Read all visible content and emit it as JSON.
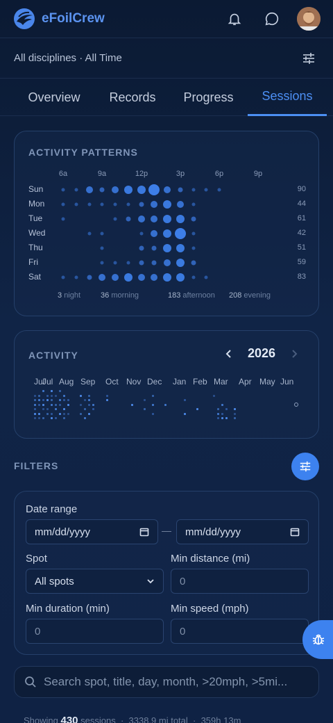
{
  "app": {
    "name": "eFoilCrew"
  },
  "context": {
    "label": "All disciplines · All Time"
  },
  "tabs": [
    {
      "label": "Overview"
    },
    {
      "label": "Records"
    },
    {
      "label": "Progress"
    },
    {
      "label": "Sessions",
      "active": true
    }
  ],
  "patterns": {
    "title": "ACTIVITY PATTERNS",
    "hour_labels": [
      "6a",
      "9a",
      "12p",
      "3p",
      "6p",
      "9p"
    ],
    "days": [
      {
        "label": "Sun",
        "total": "90",
        "levels": [
          0,
          0,
          0,
          0,
          0,
          0,
          1,
          1,
          3,
          2,
          3,
          4,
          4,
          5,
          3,
          2,
          1,
          1,
          1,
          0,
          0,
          0,
          0,
          0
        ]
      },
      {
        "label": "Mon",
        "total": "44",
        "levels": [
          0,
          0,
          0,
          1,
          0,
          0,
          1,
          1,
          1,
          1,
          1,
          1,
          2,
          3,
          4,
          3,
          1,
          0,
          0,
          0,
          0,
          0,
          0,
          0
        ]
      },
      {
        "label": "Tue",
        "total": "61",
        "levels": [
          0,
          0,
          0,
          0,
          0,
          0,
          1,
          0,
          0,
          0,
          1,
          2,
          3,
          3,
          4,
          4,
          2,
          0,
          0,
          0,
          0,
          0,
          0,
          0
        ]
      },
      {
        "label": "Wed",
        "total": "42",
        "levels": [
          0,
          0,
          0,
          0,
          0,
          0,
          0,
          0,
          1,
          1,
          0,
          0,
          1,
          3,
          4,
          5,
          1,
          0,
          0,
          0,
          0,
          0,
          0,
          0
        ]
      },
      {
        "label": "Thu",
        "total": "51",
        "levels": [
          0,
          0,
          0,
          0,
          0,
          0,
          0,
          0,
          0,
          1,
          0,
          0,
          2,
          2,
          4,
          4,
          1,
          0,
          0,
          0,
          0,
          0,
          0,
          0
        ]
      },
      {
        "label": "Fri",
        "total": "59",
        "levels": [
          0,
          0,
          0,
          0,
          1,
          0,
          0,
          0,
          0,
          1,
          1,
          1,
          2,
          2,
          3,
          4,
          2,
          0,
          0,
          0,
          0,
          0,
          0,
          0
        ]
      },
      {
        "label": "Sat",
        "total": "83",
        "levels": [
          0,
          0,
          0,
          0,
          0,
          0,
          1,
          1,
          2,
          3,
          3,
          4,
          3,
          3,
          4,
          4,
          1,
          1,
          0,
          0,
          0,
          0,
          0,
          0
        ]
      }
    ],
    "summary": [
      {
        "value": "3",
        "label": "night"
      },
      {
        "value": "36",
        "label": "morning"
      },
      {
        "value": "183",
        "label": "afternoon"
      },
      {
        "value": "208",
        "label": "evening"
      }
    ]
  },
  "activity": {
    "title": "ACTIVITY",
    "year": "2026",
    "months": [
      "Jul",
      "Jul",
      "Aug",
      "Sep",
      "Oct",
      "Nov",
      "Dec",
      "Jan",
      "Feb",
      "Mar",
      "Apr",
      "May",
      "Jun"
    ]
  },
  "filters": {
    "title": "FILTERS",
    "date_range_label": "Date range",
    "date_from": "mm/dd/yyyy",
    "date_to": "mm/dd/yyyy",
    "spot_label": "Spot",
    "spot_value": "All spots",
    "min_distance_label": "Min distance (mi)",
    "min_distance_value": "0",
    "min_duration_label": "Min duration (min)",
    "min_duration_value": "0",
    "min_speed_label": "Min speed (mph)",
    "min_speed_value": "0"
  },
  "search": {
    "placeholder": "Search spot, title, day, month, >20mph, >5mi..."
  },
  "footer": {
    "showing_prefix": "Showing",
    "count": "430",
    "count_suffix": "sessions",
    "distance": "3338.9 mi total",
    "duration": "359h 13m"
  },
  "colors": {
    "accent": "#4c8ff3",
    "background": "#0f2244",
    "dot": "#3d7ee8"
  }
}
